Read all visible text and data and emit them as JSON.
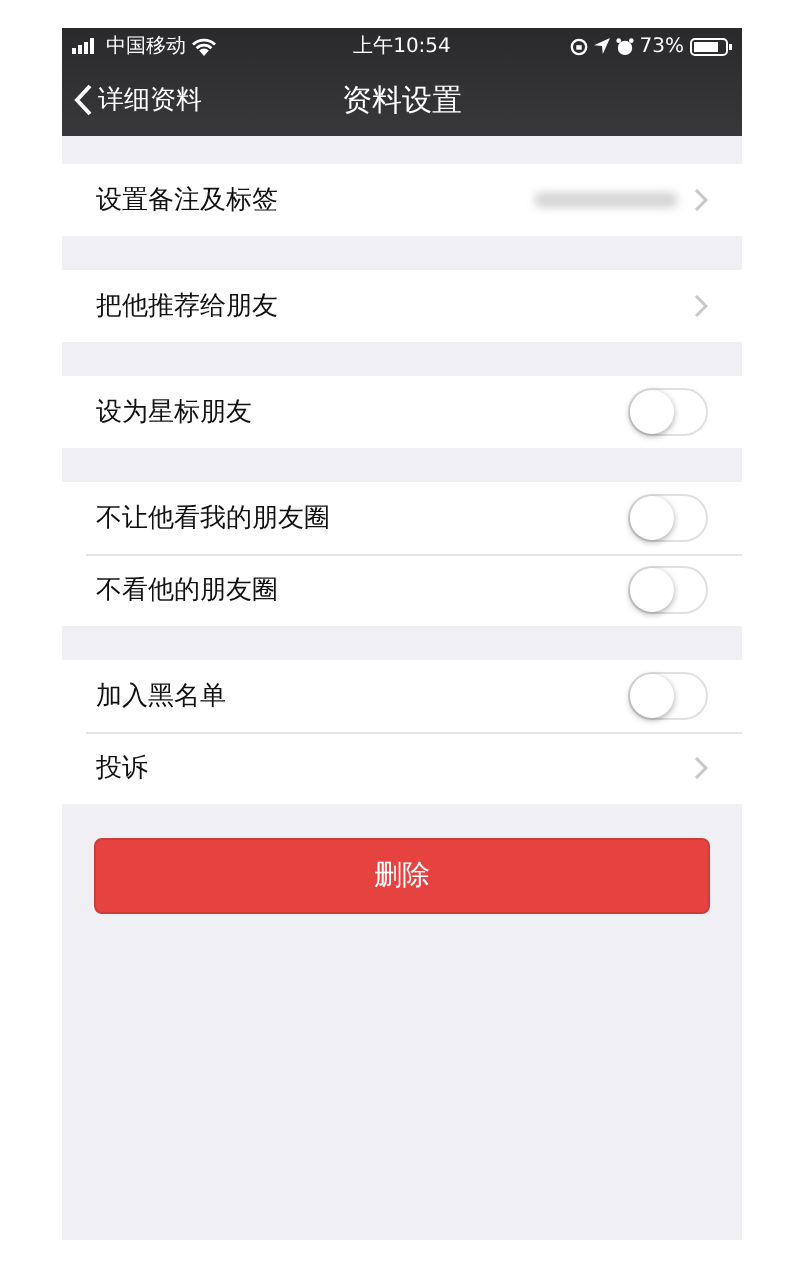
{
  "status_bar": {
    "carrier": "中国移动",
    "time": "上午10:54",
    "battery": "73%"
  },
  "nav": {
    "back": "详细资料",
    "title": "资料设置"
  },
  "groups": [
    [
      {
        "kind": "link",
        "label": "设置备注及标签",
        "redacted_value": true
      }
    ],
    [
      {
        "kind": "link",
        "label": "把他推荐给朋友"
      }
    ],
    [
      {
        "kind": "toggle",
        "label": "设为星标朋友",
        "on": false
      }
    ],
    [
      {
        "kind": "toggle",
        "label": "不让他看我的朋友圈",
        "on": false
      },
      {
        "kind": "toggle",
        "label": "不看他的朋友圈",
        "on": false
      }
    ],
    [
      {
        "kind": "toggle",
        "label": "加入黑名单",
        "on": false
      },
      {
        "kind": "link",
        "label": "投诉"
      }
    ]
  ],
  "delete_button": "删除"
}
